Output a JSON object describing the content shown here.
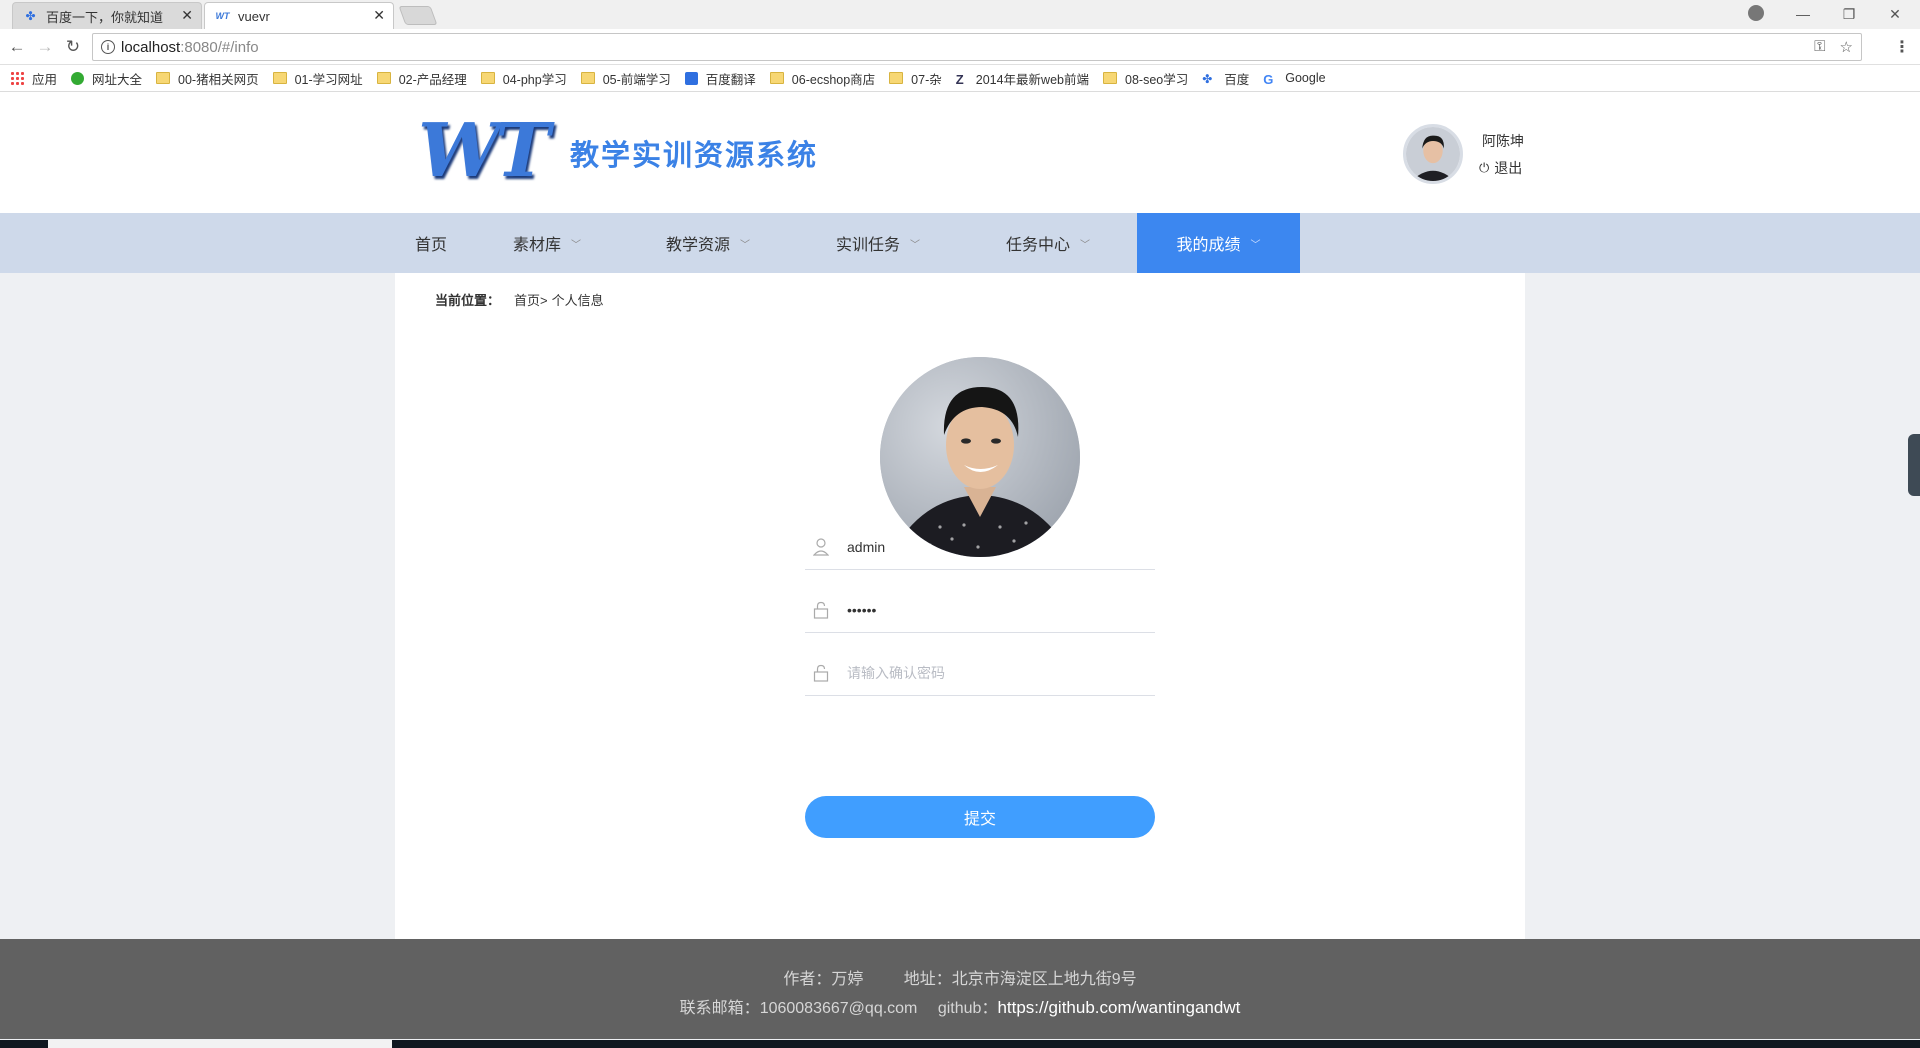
{
  "browser": {
    "tabs": [
      {
        "title": "百度一下，你就知道",
        "active": false
      },
      {
        "title": "vuevr",
        "active": true
      }
    ],
    "address": {
      "host": "localhost",
      "path": ":8080/#/info"
    },
    "bookmarks": [
      {
        "label": "应用",
        "icon": "apps-grid-icon"
      },
      {
        "label": "网址大全",
        "icon": "site-icon"
      },
      {
        "label": "00-猪相关网页",
        "icon": "folder-icon"
      },
      {
        "label": "01-学习网址",
        "icon": "folder-icon"
      },
      {
        "label": "02-产品经理",
        "icon": "folder-icon"
      },
      {
        "label": "04-php学习",
        "icon": "folder-icon"
      },
      {
        "label": "05-前端学习",
        "icon": "folder-icon"
      },
      {
        "label": "百度翻译",
        "icon": "translate-icon"
      },
      {
        "label": "06-ecshop商店",
        "icon": "folder-icon"
      },
      {
        "label": "07-杂",
        "icon": "folder-icon"
      },
      {
        "label": "2014年最新web前端",
        "icon": "z-icon"
      },
      {
        "label": "08-seo学习",
        "icon": "folder-icon"
      },
      {
        "label": "百度",
        "icon": "baidu-paw-icon"
      },
      {
        "label": "Google",
        "icon": "google-icon"
      }
    ]
  },
  "header": {
    "logo_text": "WT",
    "site_title": "教学实训资源系统",
    "user_name": "阿陈坤",
    "logout_label": "退出"
  },
  "nav": {
    "items": [
      {
        "label": "首页",
        "has_dropdown": false
      },
      {
        "label": "素材库",
        "has_dropdown": true
      },
      {
        "label": "教学资源",
        "has_dropdown": true
      },
      {
        "label": "实训任务",
        "has_dropdown": true
      },
      {
        "label": "任务中心",
        "has_dropdown": true
      },
      {
        "label": "我的成绩",
        "has_dropdown": true,
        "active": true
      }
    ],
    "active_color": "#3c87f0"
  },
  "breadcrumb": {
    "label": "当前位置：",
    "home": "首页>",
    "current": "个人信息"
  },
  "form": {
    "username_value": "admin",
    "password_value": "••••••",
    "confirm_placeholder": "请输入确认密码",
    "submit_label": "提交",
    "submit_color": "#409eff"
  },
  "footer": {
    "author": "作者：万婷",
    "address": "地址：北京市海淀区上地九街9号",
    "email_label": "联系邮箱：",
    "email": "1060083667@qq.com",
    "github_label": "github：",
    "github_url": "https://github.com/wantingandwt"
  }
}
